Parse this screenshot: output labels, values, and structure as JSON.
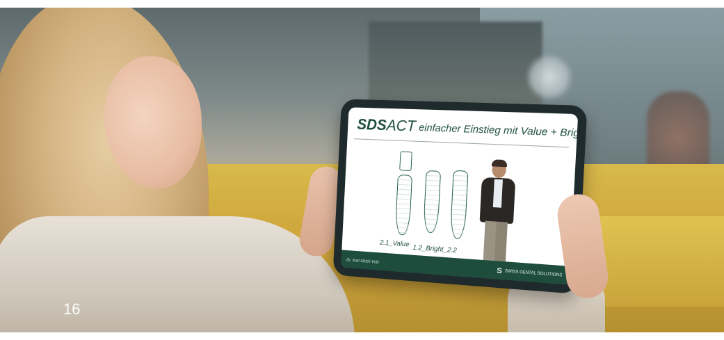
{
  "page": {
    "number": "16"
  },
  "slide": {
    "logo_bold": "SDS",
    "logo_light": "ACT",
    "title": "einfacher  Einstieg mit Value + Bright",
    "implant_label_1": "2.1_Value",
    "implant_label_2": "1.2_Bright_2.2",
    "footer_name": "Dr. Karl Ulrich Volz",
    "brand_initial": "S",
    "brand_text": "SWISS DENTAL SOLUTIONS",
    "accent_color": "#1e4d3e"
  }
}
